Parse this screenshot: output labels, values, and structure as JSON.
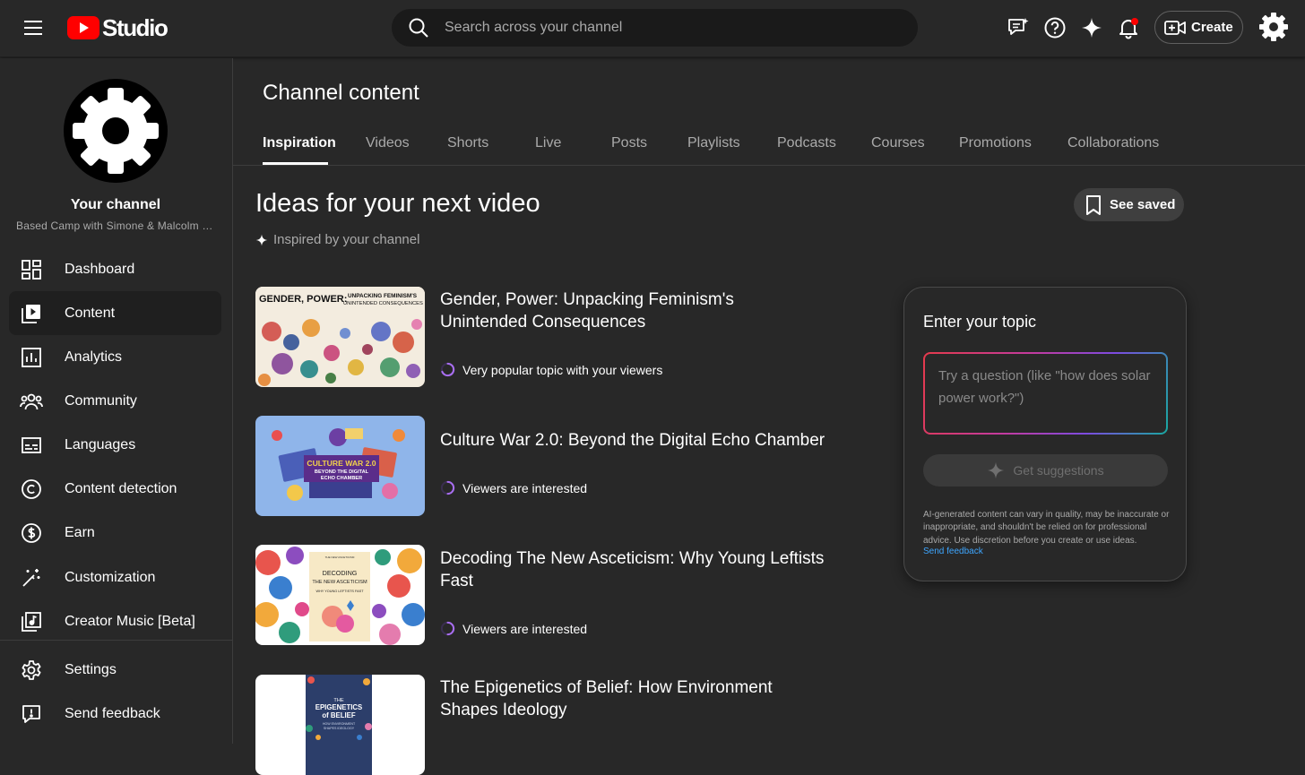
{
  "app": {
    "logo_text": "Studio"
  },
  "header": {
    "search_placeholder": "Search across your channel",
    "create_label": "Create"
  },
  "sidebar": {
    "channel_title": "Your channel",
    "channel_name": "Based Camp with Simone & Malcolm Collins",
    "items": [
      {
        "label": "Dashboard",
        "icon": "dashboard-icon"
      },
      {
        "label": "Content",
        "icon": "content-icon",
        "active": true
      },
      {
        "label": "Analytics",
        "icon": "analytics-icon"
      },
      {
        "label": "Community",
        "icon": "community-icon"
      },
      {
        "label": "Languages",
        "icon": "languages-icon"
      },
      {
        "label": "Content detection",
        "icon": "copyright-icon"
      },
      {
        "label": "Earn",
        "icon": "dollar-icon"
      },
      {
        "label": "Customization",
        "icon": "magic-wand-icon"
      },
      {
        "label": "Creator Music [Beta]",
        "icon": "music-icon"
      }
    ],
    "footer_items": [
      {
        "label": "Settings",
        "icon": "gear-icon"
      },
      {
        "label": "Send feedback",
        "icon": "feedback-icon"
      }
    ]
  },
  "main": {
    "page_title": "Channel content",
    "tabs": [
      "Inspiration",
      "Videos",
      "Shorts",
      "Live",
      "Posts",
      "Playlists",
      "Podcasts",
      "Courses",
      "Promotions",
      "Collaborations"
    ],
    "active_tab": "Inspiration",
    "heading": "Ideas for your next video",
    "subheading": "Inspired by your channel",
    "see_saved_label": "See saved",
    "ideas": [
      {
        "title": "Gender, Power: Unpacking Feminism's Unintended Consequences",
        "meta": "Very popular topic with your viewers",
        "thumb_text_left": "GENDER, POWER:",
        "thumb_text_right": "UNPACKING FEMINISM'S UNINTENDED CONSEQUENCES"
      },
      {
        "title": "Culture War 2.0: Beyond the Digital Echo Chamber",
        "meta": "Viewers are interested",
        "thumb_text": "CULTURE WAR 2.0 BEYOND THE DIGITAL ECHO CHAMBER"
      },
      {
        "title": "Decoding The New Asceticism: Why Young Leftists Fast",
        "meta": "Viewers are interested",
        "thumb_text": "DECODING THE NEW ASCETICISM WHY YOUNG LEFTISTS FAST"
      },
      {
        "title": "The Epigenetics of Belief: How Environment Shapes Ideology",
        "meta": "",
        "thumb_text": "THE EPIGENETICS OF BELIEF HOW ENVIRONMENT SHAPES IDEOLOGY"
      }
    ]
  },
  "topic_panel": {
    "title": "Enter your topic",
    "placeholder": "Try a question (like \"how does solar power work?\")",
    "button_label": "Get suggestions",
    "disclaimer": "AI-generated content can vary in quality, may be inaccurate or inappropriate, and shouldn't be relied on for professional advice. Use discretion before you create or use ideas.",
    "feedback_link": "Send feedback"
  },
  "colors": {
    "background": "#282828",
    "brand_red": "#ff0000",
    "link": "#3ea6ff",
    "indicator_purple": "#a86ef0"
  }
}
